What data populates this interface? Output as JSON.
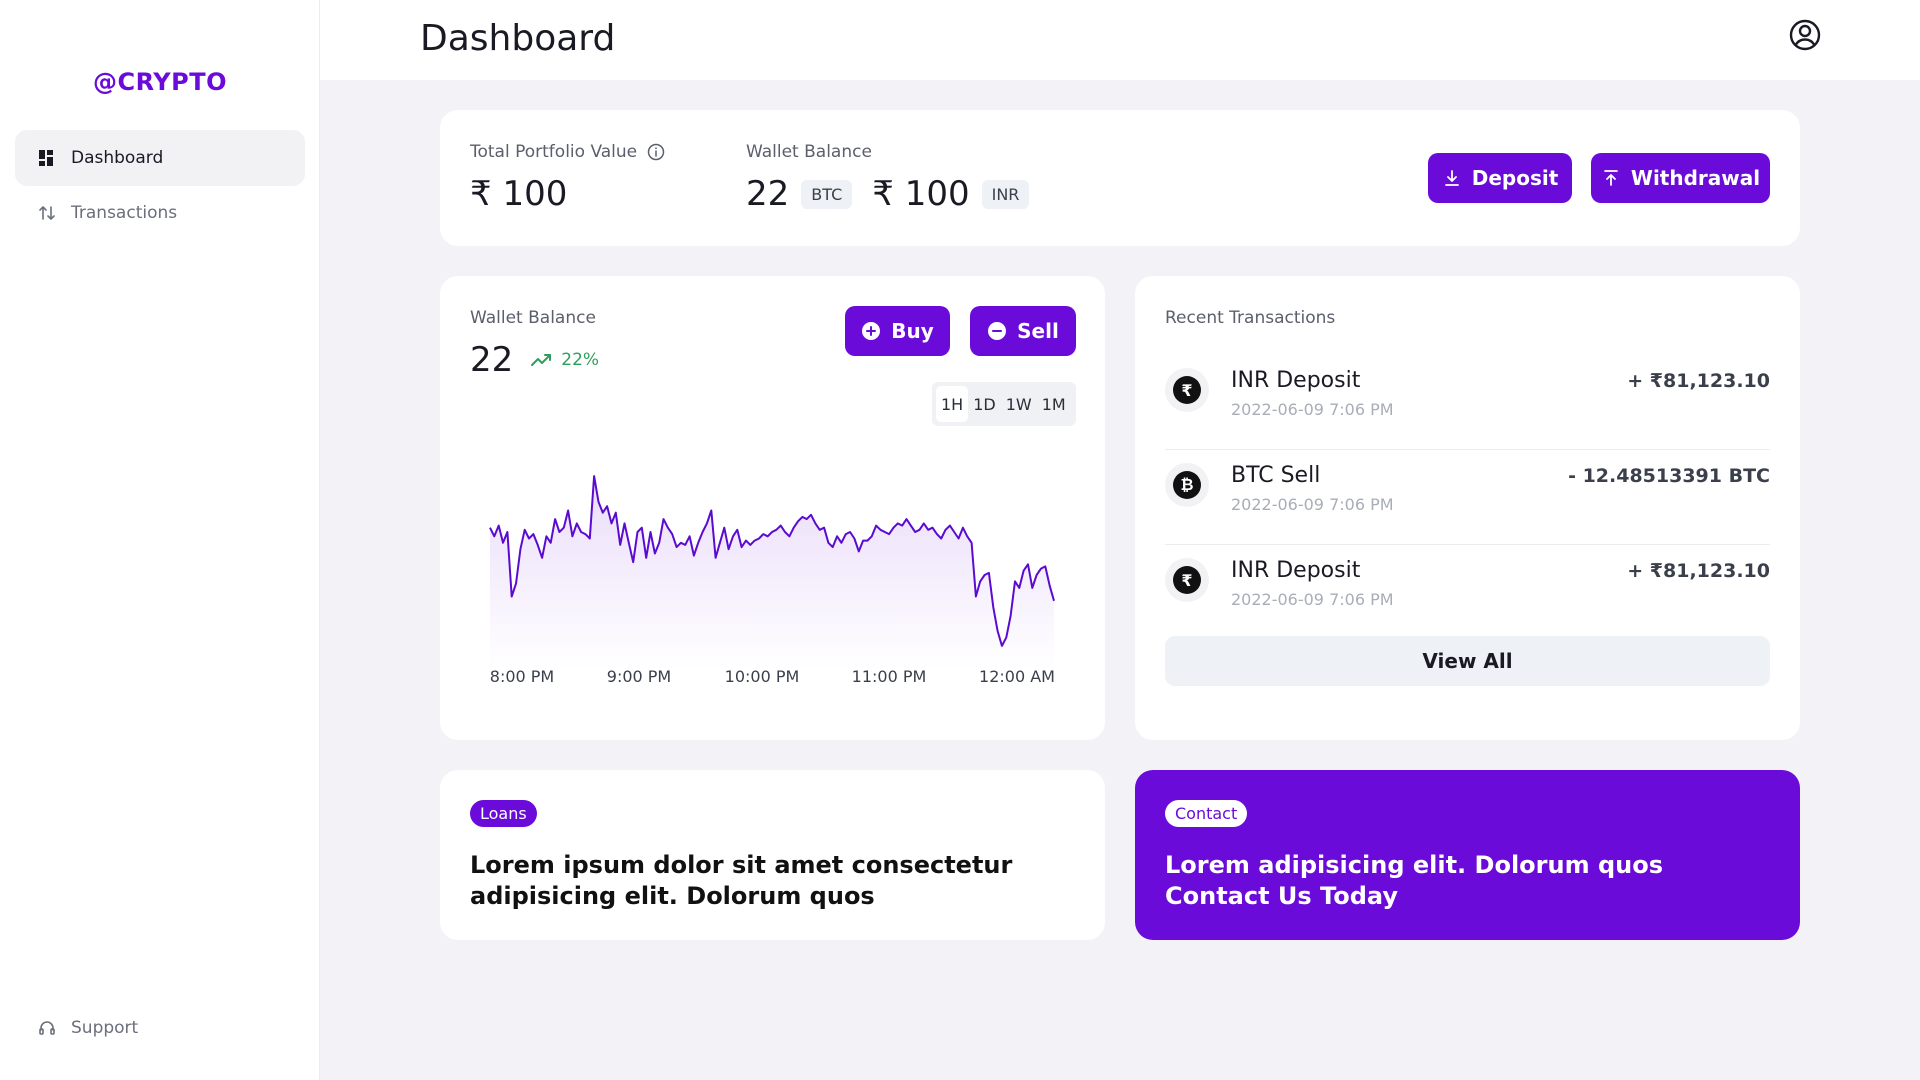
{
  "brand": "@CRYPTO",
  "nav": {
    "dashboard": "Dashboard",
    "transactions": "Transactions",
    "support": "Support"
  },
  "header": {
    "title": "Dashboard"
  },
  "portfolio": {
    "total_label": "Total Portfolio Value",
    "total_value": "₹ 100",
    "wallet_label": "Wallet Balance",
    "btc_value": "22",
    "btc_unit": "BTC",
    "inr_value": "₹ 100",
    "inr_unit": "INR",
    "deposit_label": "Deposit",
    "withdrawal_label": "Withdrawal"
  },
  "chart_card": {
    "label": "Wallet Balance",
    "value": "22",
    "change": "22%",
    "buy_label": "Buy",
    "sell_label": "Sell",
    "ranges": [
      "1H",
      "1D",
      "1W",
      "1M"
    ],
    "active_range": "1H"
  },
  "chart_data": {
    "type": "area",
    "x_ticks": [
      "8:00 PM",
      "9:00 PM",
      "10:00 PM",
      "11:00 PM",
      "12:00 AM"
    ],
    "values": [
      62,
      58,
      63,
      55,
      60,
      30,
      36,
      52,
      61,
      57,
      59,
      54,
      48,
      58,
      55,
      66,
      60,
      62,
      70,
      58,
      64,
      60,
      59,
      57,
      86,
      74,
      69,
      72,
      64,
      69,
      54,
      64,
      55,
      46,
      60,
      62,
      48,
      60,
      50,
      55,
      66,
      62,
      59,
      53,
      55,
      54,
      58,
      49,
      55,
      60,
      64,
      70,
      48,
      55,
      62,
      52,
      58,
      61,
      53,
      56,
      54,
      56,
      57,
      59,
      58,
      60,
      61,
      63,
      60,
      58,
      62,
      65,
      67,
      66,
      68,
      64,
      61,
      62,
      55,
      53,
      58,
      55,
      59,
      60,
      57,
      51,
      56,
      56,
      58,
      63,
      61,
      60,
      59,
      62,
      64,
      63,
      66,
      63,
      60,
      61,
      64,
      61,
      62,
      59,
      57,
      61,
      63,
      60,
      57,
      62,
      58,
      55,
      30,
      37,
      40,
      41,
      25,
      14,
      7,
      11,
      21,
      37,
      34,
      42,
      45,
      34,
      40,
      43,
      44,
      35,
      28
    ],
    "ylim": [
      0,
      100
    ],
    "fill": "#6a0bd9",
    "stroke": "#5a0bd0"
  },
  "recent": {
    "title": "Recent Transactions",
    "items": [
      {
        "icon": "rupee-icon",
        "glyph": "₹",
        "title": "INR Deposit",
        "date": "2022-06-09 7:06 PM",
        "amount": "+ ₹81,123.10"
      },
      {
        "icon": "bitcoin-icon",
        "glyph": "₿",
        "title": "BTC Sell",
        "date": "2022-06-09 7:06 PM",
        "amount": "- 12.48513391 BTC"
      },
      {
        "icon": "rupee-icon",
        "glyph": "₹",
        "title": "INR Deposit",
        "date": "2022-06-09 7:06 PM",
        "amount": "+ ₹81,123.10"
      }
    ],
    "view_all": "View All"
  },
  "loans": {
    "tag": "Loans",
    "text": "Lorem ipsum dolor sit amet consectetur adipisicing elit. Dolorum quos"
  },
  "contact": {
    "tag": "Contact",
    "text": "Lorem adipisicing elit. Dolorum quos Contact Us Today"
  },
  "colors": {
    "accent": "#6a0bd9",
    "positive": "#2e9e5b"
  }
}
